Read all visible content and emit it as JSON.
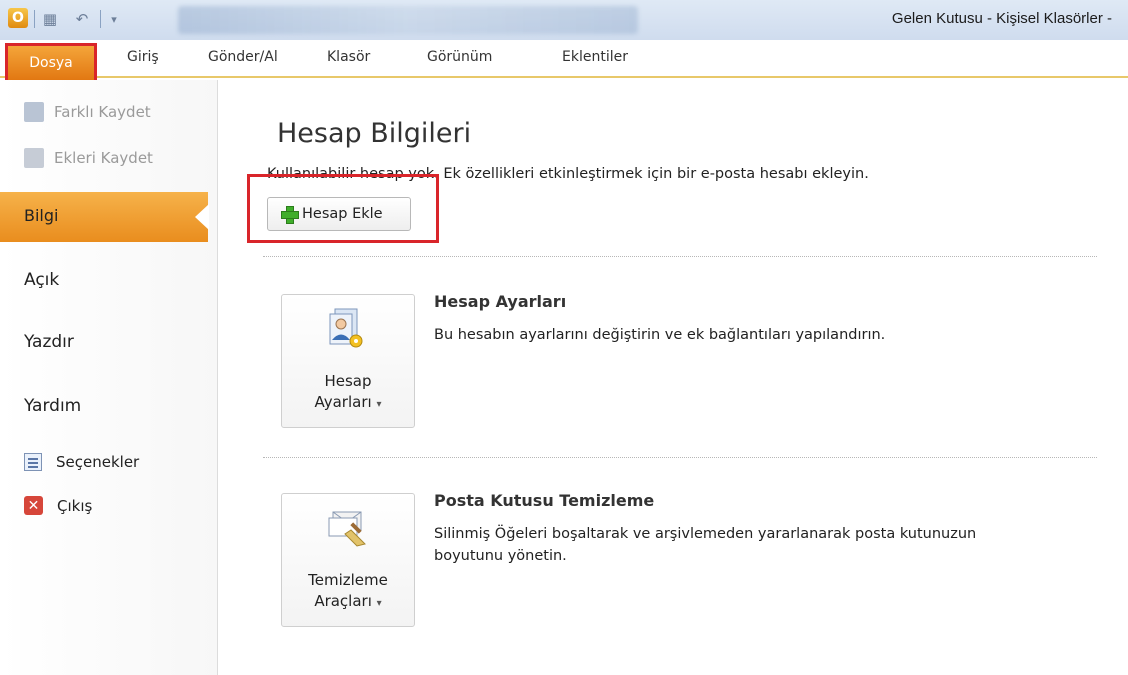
{
  "window": {
    "title": "Gelen Kutusu - Kişisel Klasörler -"
  },
  "quick_access": {
    "icons": [
      "outlook-logo-icon",
      "save-icon",
      "undo-icon",
      "customize-icon"
    ]
  },
  "ribbon": {
    "tabs": [
      {
        "label": "Dosya",
        "active": true
      },
      {
        "label": "Giriş"
      },
      {
        "label": "Gönder/Al"
      },
      {
        "label": "Klasör"
      },
      {
        "label": "Görünüm"
      },
      {
        "label": "Eklentiler"
      }
    ]
  },
  "sidebar": {
    "small_items": [
      {
        "label": "Farklı Kaydet",
        "icon": "save-as-icon",
        "enabled": false
      },
      {
        "label": "Ekleri Kaydet",
        "icon": "save-attachments-icon",
        "enabled": false
      }
    ],
    "active_item": "Bilgi",
    "items": [
      {
        "label": "Açık"
      },
      {
        "label": "Yazdır"
      },
      {
        "label": "Yardım"
      }
    ],
    "options": {
      "label": "Seçenekler",
      "icon": "options-icon"
    },
    "exit": {
      "label": "Çıkış",
      "icon": "exit-icon"
    }
  },
  "main": {
    "title": "Hesap Bilgileri",
    "subtitle": "Kullanılabilir hesap yok. Ek özellikleri etkinleştirmek için bir e-posta hesabı ekleyin.",
    "add_account_button": "Hesap Ekle",
    "sections": [
      {
        "tile_line1": "Hesap",
        "tile_line2": "Ayarları",
        "heading": "Hesap Ayarları",
        "description": "Bu hesabın ayarlarını değiştirin ve ek bağlantıları yapılandırın.",
        "icon": "account-settings-icon"
      },
      {
        "tile_line1": "Temizleme",
        "tile_line2": "Araçları",
        "heading": "Posta Kutusu Temizleme",
        "description": "Silinmiş Öğeleri boşaltarak ve arşivlemeden yararlanarak posta kutunuzun boyutunu yönetin.",
        "icon": "cleanup-tools-icon"
      }
    ]
  },
  "colors": {
    "accent_orange": "#e98d1e",
    "highlight_red": "#d9252a",
    "ribbon_gold": "#e8c86a"
  }
}
